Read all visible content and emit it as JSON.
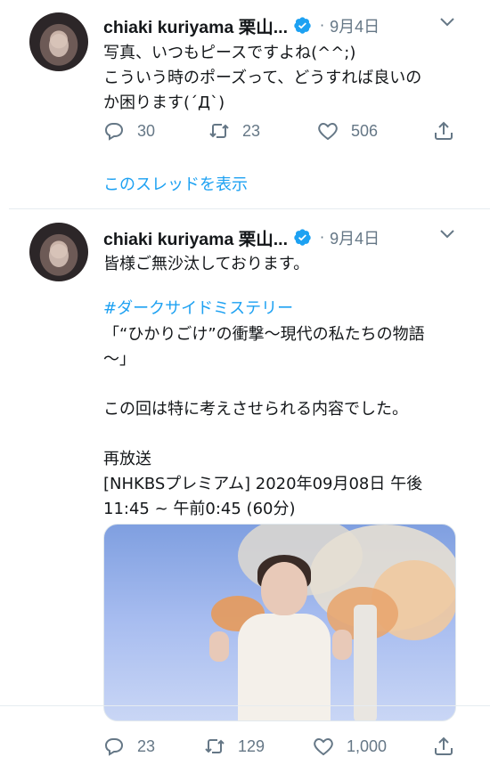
{
  "tweets": [
    {
      "author_name": "chiaki kuriyama 栗山...",
      "separator": "·",
      "date": "9月4日",
      "text": "写真、いつもピースですよね(^^;)\nこういう時のポーズって、どうすれば良いの\nか困ります(´Д`)",
      "thread_link": "このスレッドを表示",
      "replies": "30",
      "retweets": "23",
      "likes": "506"
    },
    {
      "author_name": "chiaki kuriyama 栗山...",
      "separator": "·",
      "date": "9月4日",
      "text_line1": "皆様ご無沙汰しております。",
      "hashtag": "#ダークサイドミステリー",
      "text_rest": "「“ひかりごけ”の衝撃〜現代の私たちの物語\n〜」\n\nこの回は特に考えさせられる内容でした。\n\n再放送\n[NHKBSプレミアム] 2020年09月08日 午後\n11:45 ~ 午前0:45 (60分)",
      "replies": "23",
      "retweets": "129",
      "likes": "1,000"
    }
  ],
  "icons": {
    "verified": "verified-badge-icon",
    "caret": "chevron-down-icon",
    "reply": "reply-icon",
    "retweet": "retweet-icon",
    "like": "heart-icon",
    "share": "share-icon"
  },
  "colors": {
    "accent": "#1da1f2",
    "secondary_text": "#657786",
    "primary_text": "#14171a",
    "divider": "#e6ecf0"
  }
}
